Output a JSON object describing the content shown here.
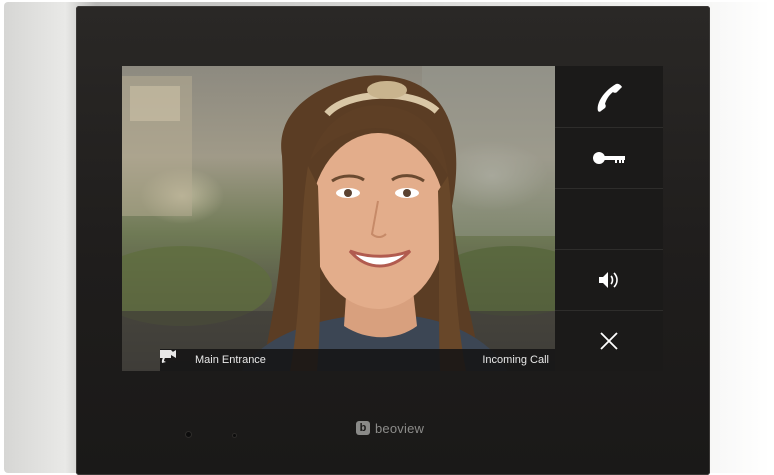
{
  "brand": {
    "mark": "b",
    "name": "beoview"
  },
  "video": {
    "camera_icon": "video-camera-icon",
    "camera_label": "Main Entrance",
    "call_icon": "phone-handset-icon",
    "call_label": "Incoming Call"
  },
  "panel": {
    "buttons": [
      {
        "id": "answer",
        "icon": "phone-handset-icon"
      },
      {
        "id": "unlock",
        "icon": "key-icon"
      },
      {
        "id": "empty",
        "icon": ""
      },
      {
        "id": "volume",
        "icon": "speaker-icon"
      },
      {
        "id": "close",
        "icon": "close-icon"
      }
    ]
  },
  "colors": {
    "bezel": "#1f1d1c",
    "panel": "#1b1a19",
    "icon": "#ffffff",
    "brand": "#8c8c8a"
  }
}
